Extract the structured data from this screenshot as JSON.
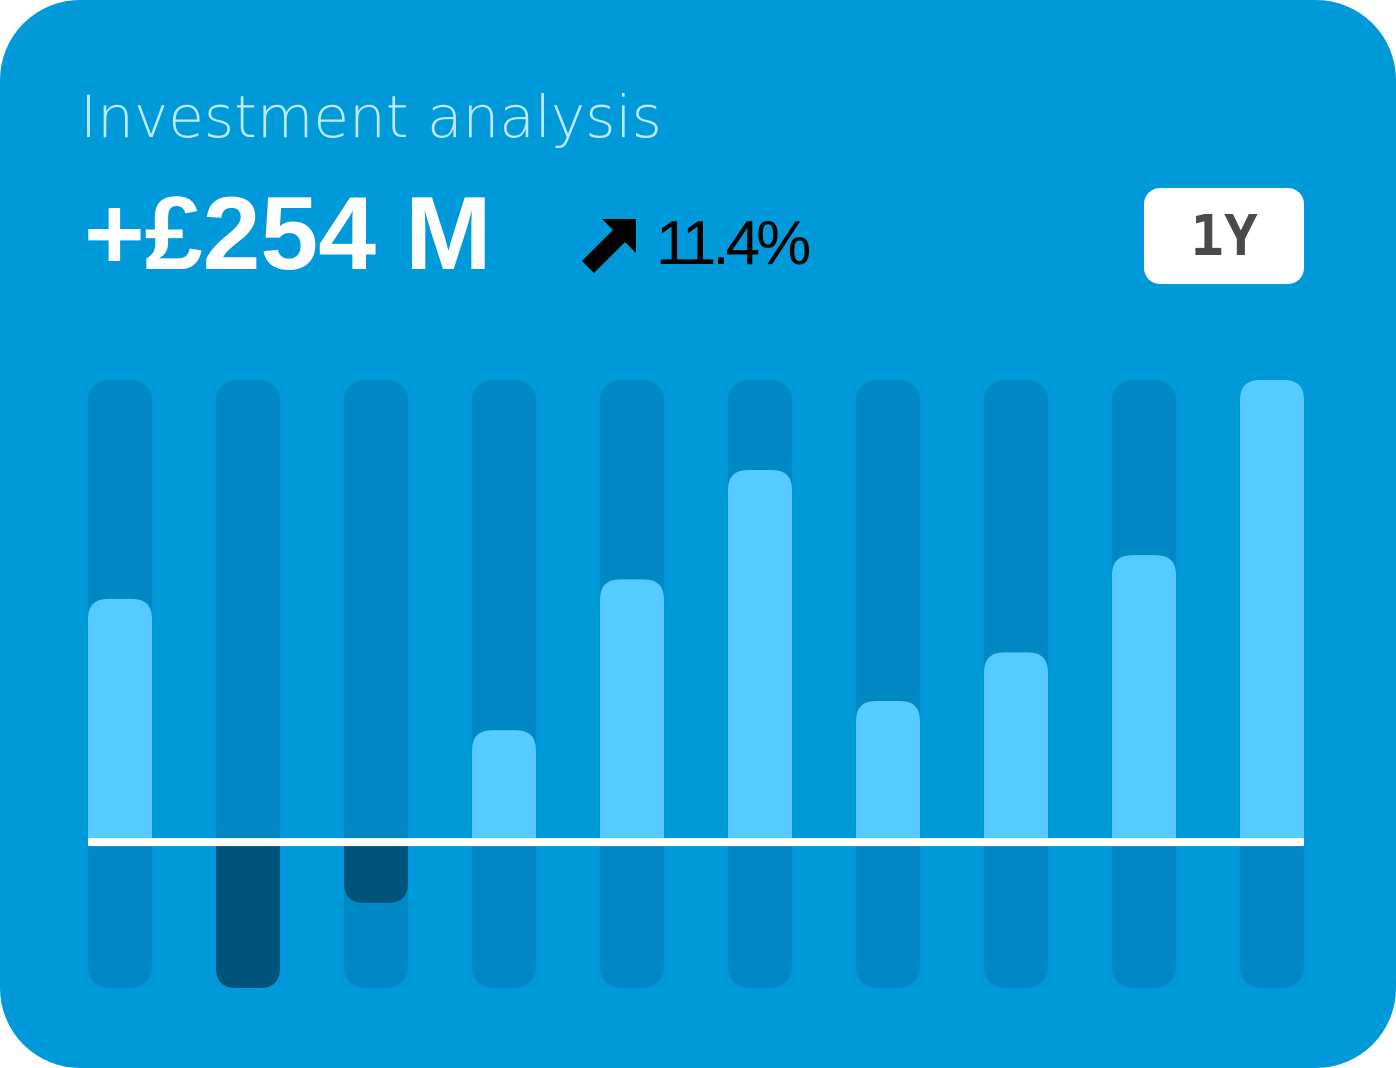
{
  "header": {
    "title": "Investment analysis",
    "value": "+£254 M",
    "change": "11.4%",
    "period": "1Y"
  },
  "icons": {
    "change_direction": "arrow-up-right-icon"
  },
  "colors": {
    "background": "#0099DA",
    "title": "#BDEBFF",
    "track": "#0088C4",
    "positive_bar": "#55CCFF",
    "negative_bar": "#00537A",
    "baseline": "#FFFFFF",
    "period_button_text": "#4A4A4A"
  },
  "chart_data": {
    "type": "bar",
    "values": [
      100,
      -60,
      -25,
      46,
      108,
      153,
      58,
      78,
      118,
      190
    ],
    "ylim": [
      -60,
      190
    ],
    "baseline": 0,
    "grid": false
  }
}
